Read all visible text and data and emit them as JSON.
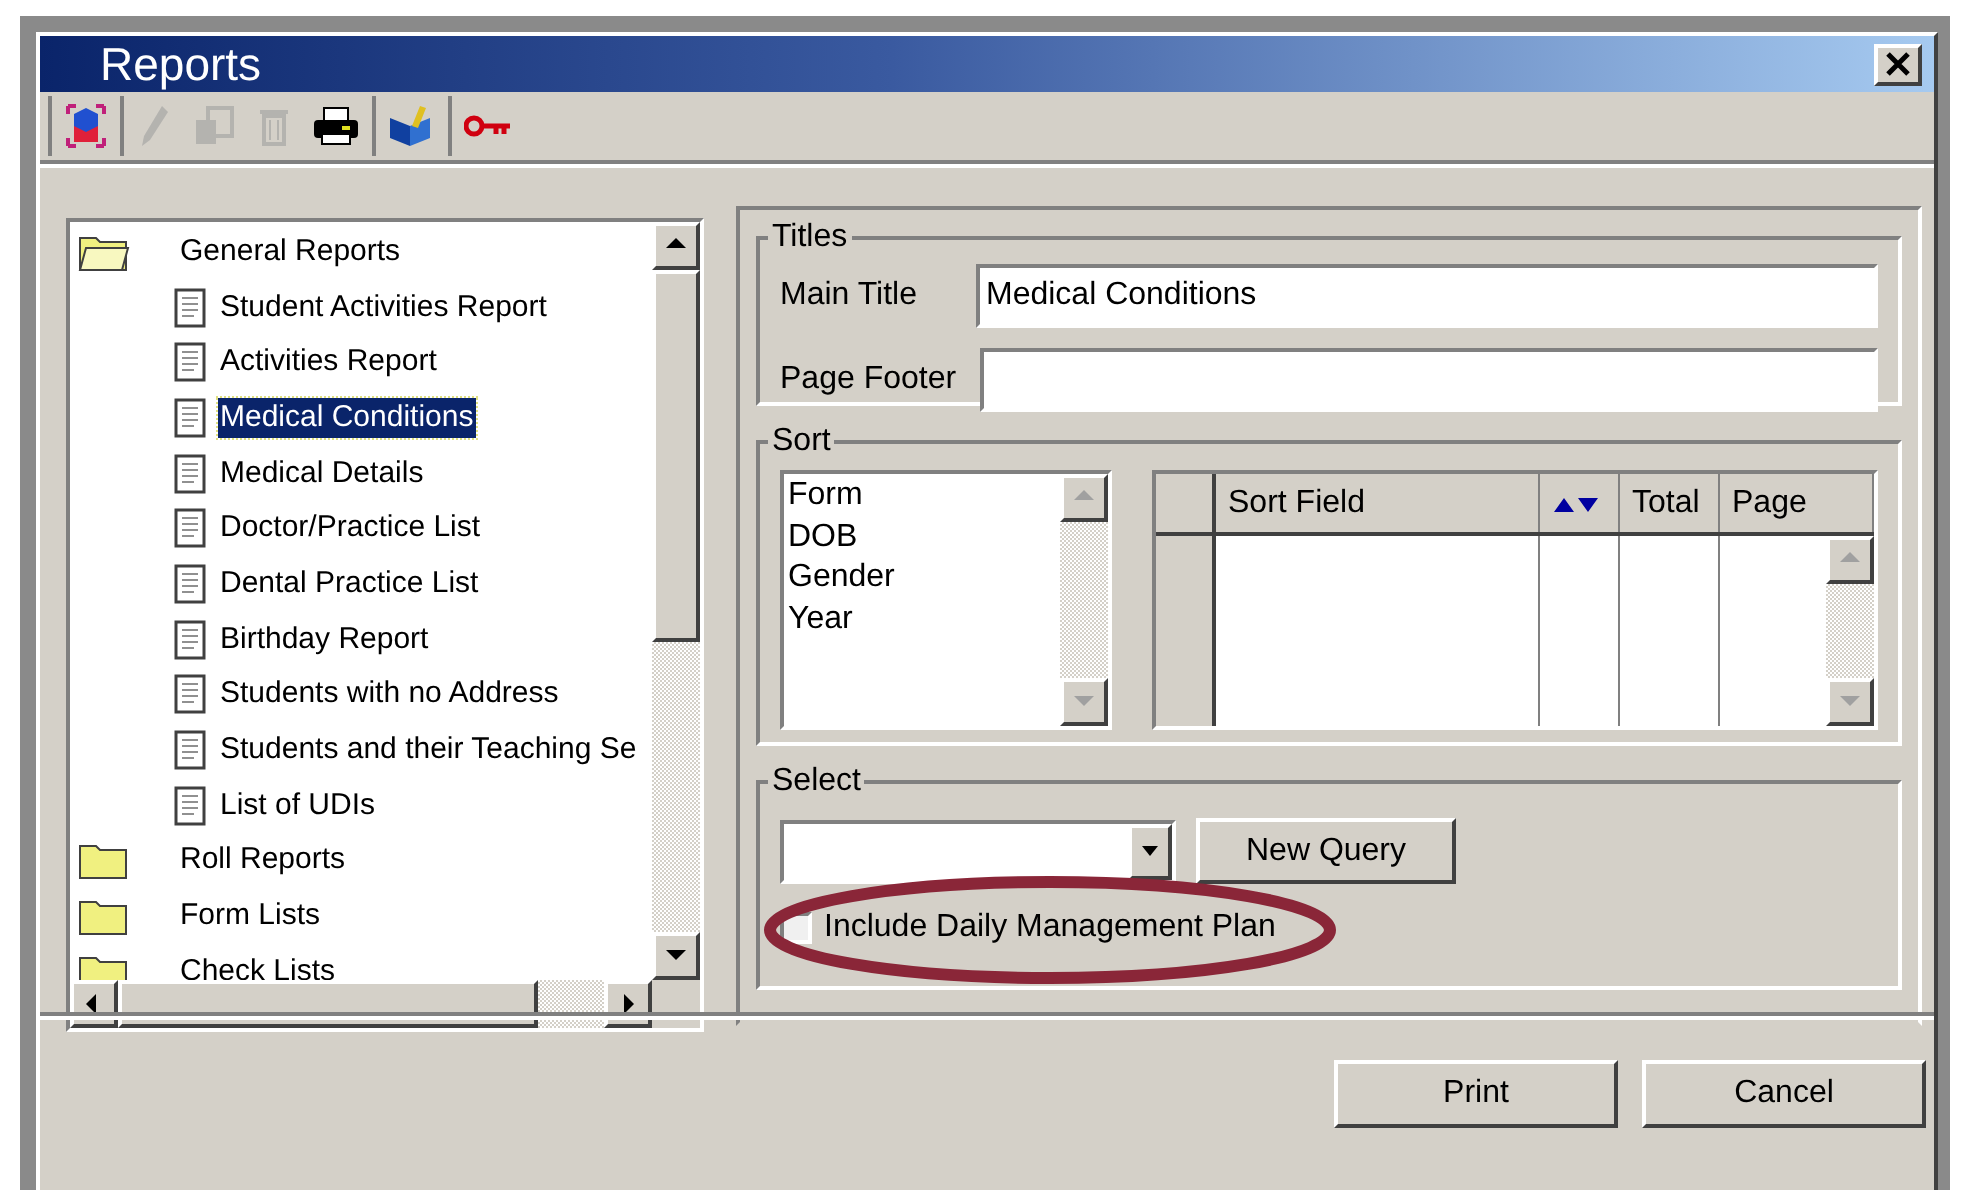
{
  "window": {
    "title": "Reports"
  },
  "toolbar": {
    "groups": [
      {
        "buttons": [
          {
            "disabled": false
          }
        ]
      },
      {
        "buttons": [
          {
            "disabled": true
          },
          {
            "disabled": true
          },
          {
            "disabled": true
          },
          {
            "disabled": false
          }
        ]
      },
      {
        "buttons": [
          {
            "disabled": false
          }
        ]
      },
      {
        "buttons": [
          {
            "disabled": false
          }
        ]
      }
    ]
  },
  "tree": [
    {
      "label": "General Reports",
      "kind": "folder",
      "expanded": true,
      "selected": false,
      "children": [
        {
          "label": "Student Activities Report",
          "kind": "report",
          "selected": false
        },
        {
          "label": "Activities Report",
          "kind": "report",
          "selected": false
        },
        {
          "label": "Medical Conditions",
          "kind": "report",
          "selected": true
        },
        {
          "label": "Medical Details",
          "kind": "report",
          "selected": false
        },
        {
          "label": "Doctor/Practice List",
          "kind": "report",
          "selected": false
        },
        {
          "label": "Dental Practice List",
          "kind": "report",
          "selected": false
        },
        {
          "label": "Birthday Report",
          "kind": "report",
          "selected": false
        },
        {
          "label": "Students with no Address",
          "kind": "report",
          "selected": false
        },
        {
          "label": "Students and their Teaching Se",
          "kind": "report",
          "selected": false
        },
        {
          "label": "List of UDIs",
          "kind": "report",
          "selected": false
        }
      ]
    },
    {
      "label": "Roll Reports",
      "kind": "folder",
      "expanded": false,
      "selected": false
    },
    {
      "label": "Form Lists",
      "kind": "folder",
      "expanded": false,
      "selected": false
    },
    {
      "label": "Check Lists",
      "kind": "folder",
      "expanded": false,
      "selected": false
    }
  ],
  "titles": {
    "legend": "Titles",
    "main_title": {
      "label": "Main Title",
      "value": "Medical Conditions"
    },
    "page_footer": {
      "label": "Page Footer"
    }
  },
  "sort": {
    "legend": "Sort",
    "fields": [
      "Form",
      "DOB",
      "Gender",
      "Year"
    ],
    "columns": [
      {
        "kind": "text",
        "label": "Sort Field"
      },
      {
        "kind": "sort-arrows"
      },
      {
        "kind": "text",
        "label": "Total"
      },
      {
        "kind": "text",
        "label": "Page"
      }
    ]
  },
  "select": {
    "legend": "Select",
    "new_query": "New Query",
    "include_plan": {
      "label": "Include Daily Management Plan",
      "checked": false,
      "highlighted": true
    }
  },
  "buttons": [
    "Print",
    "Cancel"
  ]
}
